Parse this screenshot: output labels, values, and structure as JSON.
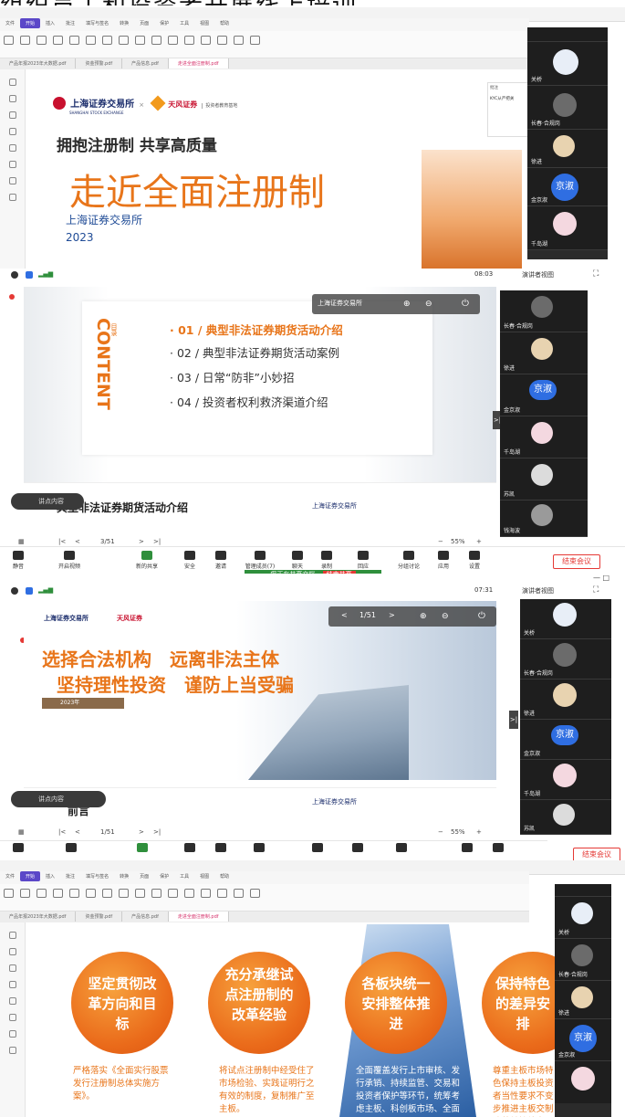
{
  "caption": "组织员工和投资者开展线上培训",
  "panel1": {
    "tabs": [
      "文件",
      "开始",
      "插入",
      "批注",
      "填写与签名",
      "转换",
      "页面",
      "保护",
      "工具",
      "视图",
      "帮助"
    ],
    "doc_tabs": [
      "产品年报2023年大数据.pdf",
      "资金预警.pdf",
      "产品信息.pdf",
      "走进全面注册制.pdf"
    ],
    "brand_sse": "上海证券交易所",
    "brand_sse_en": "SHANGHAI STOCK EXCHANGE",
    "brand_tf": "天风证券",
    "brand_tag": "投资者教育基地",
    "subtitle": "拥抱注册制 共享高质量",
    "title": "走近全面注册制",
    "org": "上海证券交易所",
    "year": "2023",
    "names": [
      "关桥",
      "长春·合规岗",
      "徐进",
      "金京淑",
      "千岛湖"
    ],
    "jingshu": "京淑",
    "comment_title": "批注",
    "comment_text": "KYC从严把关"
  },
  "panel2": {
    "time": "08:03",
    "view_label": "演讲者视图",
    "slide_indicator": "3/51",
    "content_label": "CONTENT",
    "mulu": "目录",
    "items": [
      "· 01 / 典型非法证券期货活动介绍",
      "· 02 / 典型非法证券期货活动案例",
      "· 03 / 日常“防非”小妙招",
      "· 04 / 投资者权利救济渠道介绍"
    ],
    "next_title": "典型非法证券期货活动介绍",
    "speaker_text": "讲点内容",
    "zoom": "55%",
    "names": [
      "长春·合规岗",
      "徐进",
      "金京淑",
      "千岛湖",
      "苏凯",
      "钱海波"
    ],
    "jingshu": "京淑",
    "toolbar": [
      "静音",
      "开启视频",
      "新的共享",
      "安全",
      "邀请",
      "管理成员(7)",
      "聊天",
      "录制",
      "回应",
      "分组讨论",
      "应用",
      "设置"
    ],
    "end_label": "结束会议",
    "share_status": "您正在共享文档",
    "end_share": "结束共享"
  },
  "panel3": {
    "time": "07:31",
    "view_label": "演讲者视图",
    "slide_indicator": "1/51",
    "line1": "选择合法机构　远离非法主体",
    "line2": "坚持理性投资　谨防上当受骗",
    "year_chip": "2023年",
    "next_title": "前言",
    "speaker_text": "讲点内容",
    "zoom": "55%",
    "names": [
      "关桥",
      "长春·合规岗",
      "徐进",
      "金京淑",
      "千岛湖",
      "苏凯"
    ],
    "jingshu": "京淑",
    "end_label": "结束会议"
  },
  "panel4": {
    "circles": [
      "坚定贯彻改革方向和目标",
      "充分承继试点注册制的改革经验",
      "各板块统一安排整体推进",
      "保持特色的差异安排"
    ],
    "descs": [
      "严格落实《全面实行股票发行注册制总体实施方案》。",
      "将试点注册制中经受住了市场检验、实践证明行之有效的制度，复制推广至主板。",
      "全面覆盖发行上市审核、发行承销、持续监管、交易和投资者保护等环节，统筹考虑主板、科创板市场、全面适",
      "尊重主板市场特色保持主板投资者当性要求不变步推进主板交制改革并持续完善，继续"
    ],
    "jingshu": "京淑",
    "names": [
      "关桥",
      "长春·合规岗",
      "徐进",
      "金京淑"
    ]
  }
}
